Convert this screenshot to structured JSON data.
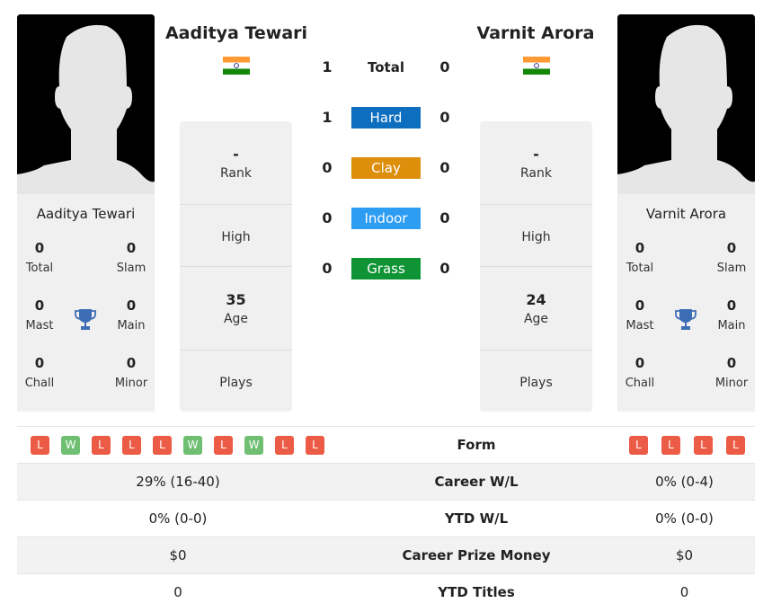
{
  "colors": {
    "hard": "#0d6ebf",
    "clay": "#dd8e0a",
    "indoor": "#2d9cf3",
    "grass": "#0e9435",
    "loss": "#ec5b45",
    "win": "#6fbf73",
    "trophy": "#3c6db5"
  },
  "player1": {
    "name": "Aaditya Tewari",
    "country_flag": "india-flag",
    "titles": {
      "total": {
        "value": "0",
        "label": "Total"
      },
      "slam": {
        "value": "0",
        "label": "Slam"
      },
      "mast": {
        "value": "0",
        "label": "Mast"
      },
      "main": {
        "value": "0",
        "label": "Main"
      },
      "chall": {
        "value": "0",
        "label": "Chall"
      },
      "minor": {
        "value": "0",
        "label": "Minor"
      }
    },
    "info": {
      "rank": {
        "value": "-",
        "label": "Rank"
      },
      "high": {
        "value": "",
        "label": "High"
      },
      "age": {
        "value": "35",
        "label": "Age"
      },
      "plays": {
        "value": "",
        "label": "Plays"
      }
    }
  },
  "player2": {
    "name": "Varnit Arora",
    "country_flag": "india-flag",
    "titles": {
      "total": {
        "value": "0",
        "label": "Total"
      },
      "slam": {
        "value": "0",
        "label": "Slam"
      },
      "mast": {
        "value": "0",
        "label": "Mast"
      },
      "main": {
        "value": "0",
        "label": "Main"
      },
      "chall": {
        "value": "0",
        "label": "Chall"
      },
      "minor": {
        "value": "0",
        "label": "Minor"
      }
    },
    "info": {
      "rank": {
        "value": "-",
        "label": "Rank"
      },
      "high": {
        "value": "",
        "label": "High"
      },
      "age": {
        "value": "24",
        "label": "Age"
      },
      "plays": {
        "value": "",
        "label": "Plays"
      }
    }
  },
  "h2h": [
    {
      "label": "Total",
      "p1": "1",
      "p2": "0",
      "kind": "total"
    },
    {
      "label": "Hard",
      "p1": "1",
      "p2": "0",
      "kind": "hard"
    },
    {
      "label": "Clay",
      "p1": "0",
      "p2": "0",
      "kind": "clay"
    },
    {
      "label": "Indoor",
      "p1": "0",
      "p2": "0",
      "kind": "indoor"
    },
    {
      "label": "Grass",
      "p1": "0",
      "p2": "0",
      "kind": "grass"
    }
  ],
  "stats": {
    "form": {
      "label": "Form",
      "p1": [
        "L",
        "W",
        "L",
        "L",
        "L",
        "W",
        "L",
        "W",
        "L",
        "L"
      ],
      "p2": [
        "L",
        "L",
        "L",
        "L"
      ]
    },
    "rows": [
      {
        "label": "Career W/L",
        "p1": "29% (16-40)",
        "p2": "0% (0-4)"
      },
      {
        "label": "YTD W/L",
        "p1": "0% (0-0)",
        "p2": "0% (0-0)"
      },
      {
        "label": "Career Prize Money",
        "p1": "$0",
        "p2": "$0"
      },
      {
        "label": "YTD Titles",
        "p1": "0",
        "p2": "0"
      }
    ]
  }
}
